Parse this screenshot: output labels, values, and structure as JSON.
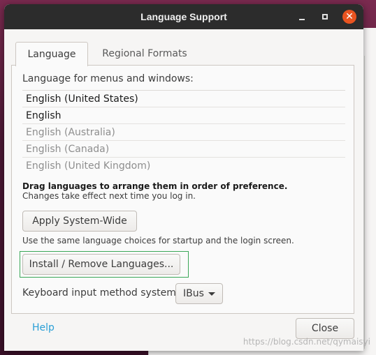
{
  "window": {
    "title": "Language Support",
    "close_glyph": "✕"
  },
  "tabs": [
    {
      "label": "Language",
      "active": true
    },
    {
      "label": "Regional Formats",
      "active": false
    }
  ],
  "language_section": {
    "label": "Language for menus and windows:",
    "languages": [
      {
        "name": "English (United States)",
        "enabled": true
      },
      {
        "name": "English",
        "enabled": true
      },
      {
        "name": "English (Australia)",
        "enabled": false
      },
      {
        "name": "English (Canada)",
        "enabled": false
      },
      {
        "name": "English (United Kingdom)",
        "enabled": false
      }
    ],
    "hint_bold": "Drag languages to arrange them in order of preference.",
    "hint": "Changes take effect next time you log in."
  },
  "buttons": {
    "apply": "Apply System-Wide",
    "apply_note": "Use the same language choices for startup and the login screen.",
    "install": "Install / Remove Languages...",
    "close": "Close"
  },
  "keyboard": {
    "label": "Keyboard input method system:",
    "selected": "IBus"
  },
  "footer": {
    "help": "Help"
  },
  "watermark": "https://blog.csdn.net/qymaisyi",
  "colors": {
    "titlebar": "#2c2c2c",
    "close_button": "#e95420",
    "help_link": "#2a9fd6",
    "focus_ring": "#3aa757"
  }
}
